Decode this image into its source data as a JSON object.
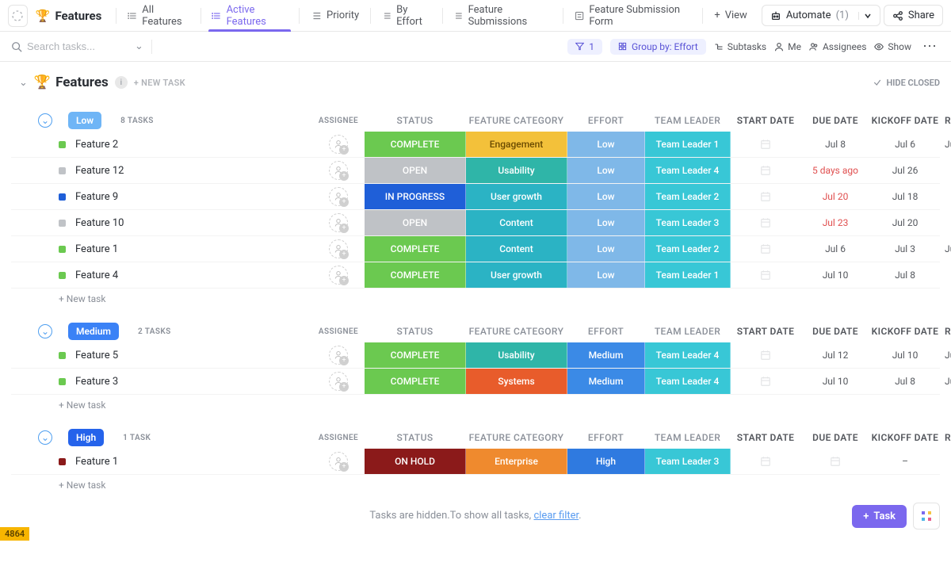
{
  "header": {
    "title": "Features",
    "trophy": "🏆",
    "tabs": [
      {
        "label": "All Features"
      },
      {
        "label": "Active Features"
      },
      {
        "label": "Priority"
      },
      {
        "label": "By Effort"
      },
      {
        "label": "Feature Submissions"
      },
      {
        "label": "Feature Submission Form"
      }
    ],
    "add_view": "View",
    "automate": "Automate",
    "automate_count": "(1)",
    "share": "Share"
  },
  "toolbar": {
    "search_placeholder": "Search tasks...",
    "filter_count": "1",
    "group_by": "Group by: Effort",
    "subtasks": "Subtasks",
    "me": "Me",
    "assignees": "Assignees",
    "show": "Show"
  },
  "list": {
    "title": "Features",
    "new_task": "+ NEW TASK",
    "hide_closed": "HIDE CLOSED",
    "new_task_row": "+ New task"
  },
  "columns": [
    "ASSIGNEE",
    "STATUS",
    "FEATURE CATEGORY",
    "EFFORT",
    "TEAM LEADER",
    "START DATE",
    "DUE DATE",
    "KICKOFF DATE",
    "REVIEW"
  ],
  "groups": [
    {
      "name": "Low",
      "badge_class": "low",
      "count": "8 TASKS",
      "tasks": [
        {
          "name": "Feature 2",
          "status": "COMPLETE",
          "status_c": "c-complete",
          "dot": "dot-complete",
          "category": "Engagement",
          "cat_c": "c-engagement",
          "effort": "Low",
          "eff_c": "c-low",
          "leader": "Team Leader 1",
          "start": "",
          "due": "Jul 8",
          "due_overdue": false,
          "kickoff": "Jul 6",
          "review": "Ju"
        },
        {
          "name": "Feature 12",
          "status": "OPEN",
          "status_c": "c-open",
          "dot": "dot-open",
          "category": "Usability",
          "cat_c": "c-usability",
          "effort": "Low",
          "eff_c": "c-low",
          "leader": "Team Leader 4",
          "start": "",
          "due": "5 days ago",
          "due_overdue": true,
          "kickoff": "Jul 26",
          "review": ""
        },
        {
          "name": "Feature 9",
          "status": "IN PROGRESS",
          "status_c": "c-inprogress",
          "dot": "dot-inprogress",
          "category": "User growth",
          "cat_c": "c-usergrowth",
          "effort": "Low",
          "eff_c": "c-low",
          "leader": "Team Leader 2",
          "start": "",
          "due": "Jul 20",
          "due_overdue": true,
          "kickoff": "Jul 18",
          "review": ""
        },
        {
          "name": "Feature 10",
          "status": "OPEN",
          "status_c": "c-open",
          "dot": "dot-open",
          "category": "Content",
          "cat_c": "c-content",
          "effort": "Low",
          "eff_c": "c-low",
          "leader": "Team Leader 3",
          "start": "",
          "due": "Jul 23",
          "due_overdue": true,
          "kickoff": "Jul 20",
          "review": ""
        },
        {
          "name": "Feature 1",
          "status": "COMPLETE",
          "status_c": "c-complete",
          "dot": "dot-complete",
          "category": "Content",
          "cat_c": "c-content",
          "effort": "Low",
          "eff_c": "c-low",
          "leader": "Team Leader 2",
          "start": "",
          "due": "Jul 6",
          "due_overdue": false,
          "kickoff": "Jul 3",
          "review": "Ju"
        },
        {
          "name": "Feature 4",
          "status": "COMPLETE",
          "status_c": "c-complete",
          "dot": "dot-complete",
          "category": "User growth",
          "cat_c": "c-usergrowth",
          "effort": "Low",
          "eff_c": "c-low",
          "leader": "Team Leader 1",
          "start": "",
          "due": "Jul 10",
          "due_overdue": false,
          "kickoff": "Jul 8",
          "review": ""
        }
      ]
    },
    {
      "name": "Medium",
      "badge_class": "medium",
      "count": "2 TASKS",
      "tasks": [
        {
          "name": "Feature 5",
          "status": "COMPLETE",
          "status_c": "c-complete",
          "dot": "dot-complete",
          "category": "Usability",
          "cat_c": "c-usability",
          "effort": "Medium",
          "eff_c": "c-medium",
          "leader": "Team Leader 4",
          "start": "",
          "due": "Jul 12",
          "due_overdue": false,
          "kickoff": "Jul 10",
          "review": "Ju"
        },
        {
          "name": "Feature 3",
          "status": "COMPLETE",
          "status_c": "c-complete",
          "dot": "dot-complete",
          "category": "Systems",
          "cat_c": "c-systems",
          "effort": "Medium",
          "eff_c": "c-medium",
          "leader": "Team Leader 4",
          "start": "",
          "due": "Jul 10",
          "due_overdue": false,
          "kickoff": "Jul 8",
          "review": "Ju"
        }
      ]
    },
    {
      "name": "High",
      "badge_class": "high",
      "count": "1 TASK",
      "tasks": [
        {
          "name": "Feature 1",
          "status": "ON HOLD",
          "status_c": "c-onhold",
          "dot": "dot-onhold",
          "category": "Enterprise",
          "cat_c": "c-enterprise",
          "effort": "High",
          "eff_c": "c-high",
          "leader": "Team Leader 3",
          "start": "",
          "due": "",
          "due_overdue": false,
          "kickoff": "–",
          "review": ""
        }
      ]
    }
  ],
  "hidden_msg": {
    "prefix": "Tasks are hidden.To show all tasks, ",
    "link": "clear filter",
    "suffix": "."
  },
  "fab": {
    "task": "Task"
  },
  "corner": "4864"
}
